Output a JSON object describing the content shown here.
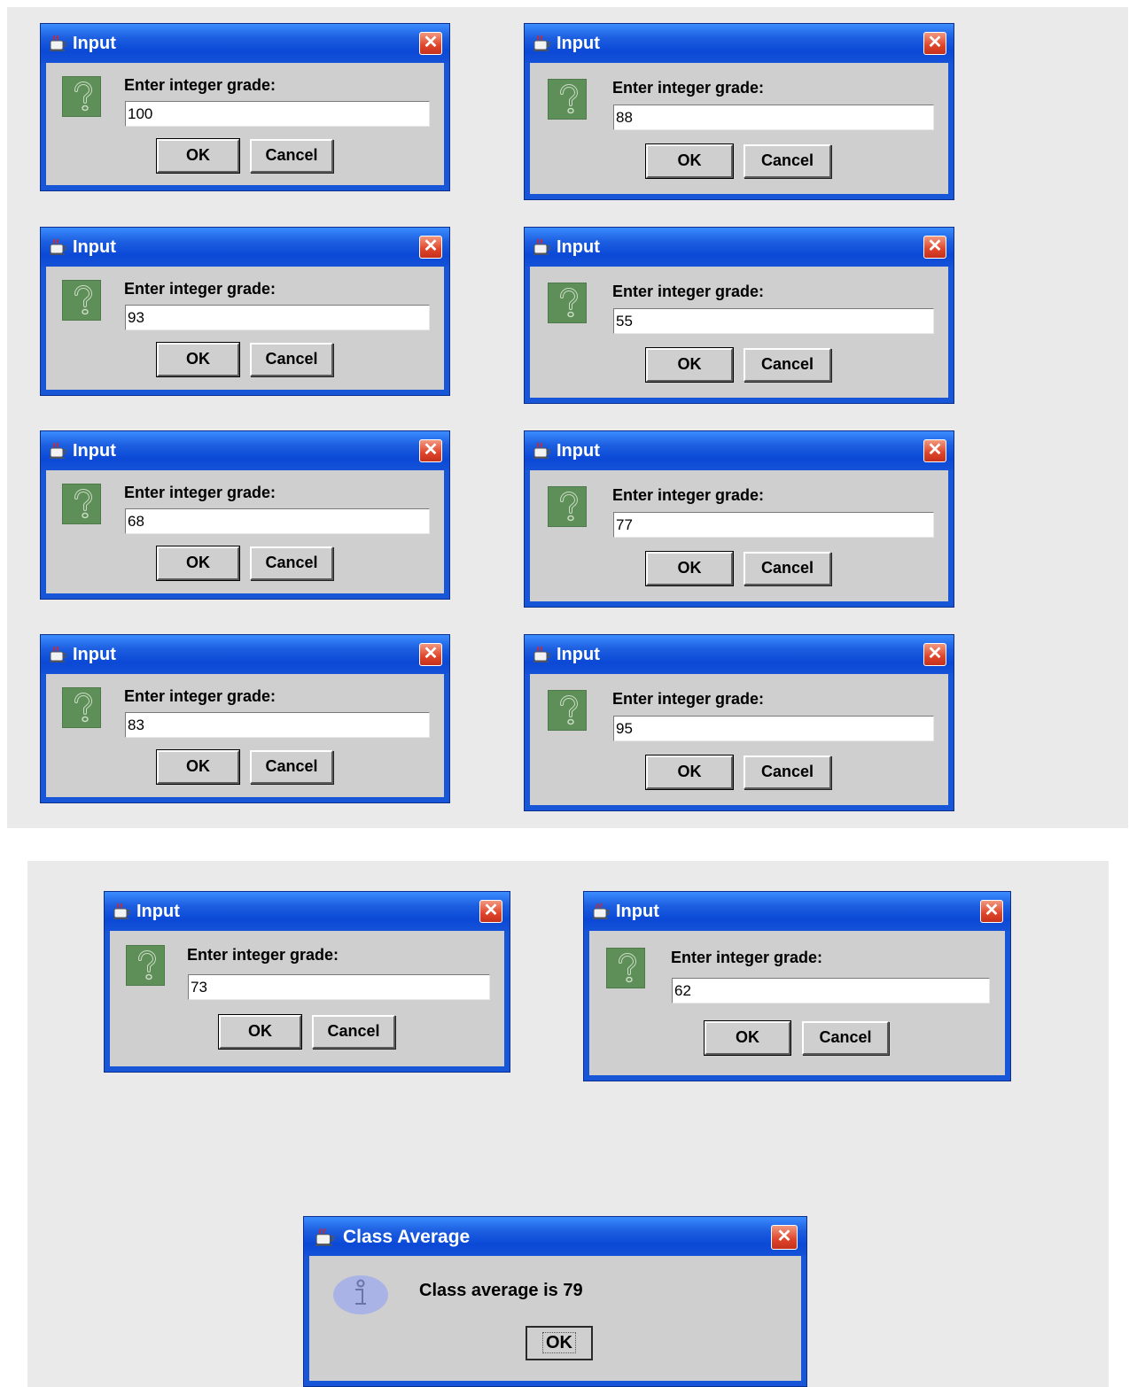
{
  "input_dialogs": [
    {
      "title": "Input",
      "prompt": "Enter integer grade:",
      "value": "100",
      "ok": "OK",
      "cancel": "Cancel"
    },
    {
      "title": "Input",
      "prompt": "Enter integer grade:",
      "value": "88",
      "ok": "OK",
      "cancel": "Cancel"
    },
    {
      "title": "Input",
      "prompt": "Enter integer grade:",
      "value": "93",
      "ok": "OK",
      "cancel": "Cancel"
    },
    {
      "title": "Input",
      "prompt": "Enter integer grade:",
      "value": "55",
      "ok": "OK",
      "cancel": "Cancel"
    },
    {
      "title": "Input",
      "prompt": "Enter integer grade:",
      "value": "68",
      "ok": "OK",
      "cancel": "Cancel"
    },
    {
      "title": "Input",
      "prompt": "Enter integer grade:",
      "value": "77",
      "ok": "OK",
      "cancel": "Cancel"
    },
    {
      "title": "Input",
      "prompt": "Enter integer grade:",
      "value": "83",
      "ok": "OK",
      "cancel": "Cancel"
    },
    {
      "title": "Input",
      "prompt": "Enter integer grade:",
      "value": "95",
      "ok": "OK",
      "cancel": "Cancel"
    },
    {
      "title": "Input",
      "prompt": "Enter integer grade:",
      "value": "73",
      "ok": "OK",
      "cancel": "Cancel"
    },
    {
      "title": "Input",
      "prompt": "Enter integer grade:",
      "value": "62",
      "ok": "OK",
      "cancel": "Cancel"
    }
  ],
  "result_dialog": {
    "title": "Class Average",
    "message": "Class average is 79",
    "ok": "OK"
  },
  "close_glyph": "✕",
  "icons": {
    "question": "question-icon",
    "info": "info-icon",
    "app": "java-cup-icon",
    "close": "close-icon"
  },
  "colors": {
    "titlebar": "#0b49d6",
    "client": "#cfcfcf",
    "question_icon": "#5e8f58",
    "info_icon": "#a9b3e6",
    "close": "#e0442a"
  }
}
